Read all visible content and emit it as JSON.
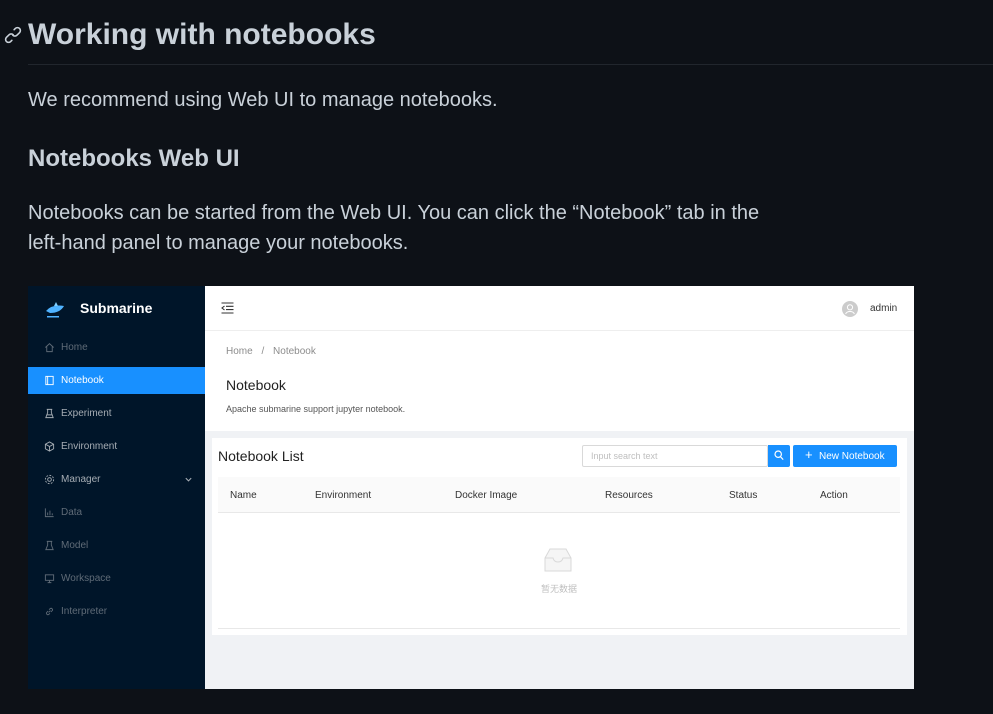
{
  "doc": {
    "heading": "Working with notebooks",
    "intro": "We recommend using Web UI to manage notebooks.",
    "subheading": "Notebooks Web UI",
    "paragraph": "Notebooks can be started from the Web UI. You can click the “Notebook” tab in the left-hand panel to manage your notebooks."
  },
  "app": {
    "brand": "Submarine",
    "menu": [
      {
        "label": "Home",
        "icon": "home-icon"
      },
      {
        "label": "Notebook",
        "icon": "book-icon"
      },
      {
        "label": "Experiment",
        "icon": "flask-icon"
      },
      {
        "label": "Environment",
        "icon": "cube-icon"
      },
      {
        "label": "Manager",
        "icon": "settings-icon"
      },
      {
        "label": "Data",
        "icon": "bar-chart-icon"
      },
      {
        "label": "Model",
        "icon": "experiment-icon"
      },
      {
        "label": "Workspace",
        "icon": "desktop-icon"
      },
      {
        "label": "Interpreter",
        "icon": "link-icon"
      }
    ],
    "user": "admin",
    "breadcrumb": [
      "Home",
      "/",
      "Notebook"
    ],
    "page_title": "Notebook",
    "page_desc": "Apache submarine support jupyter notebook.",
    "list_title": "Notebook List",
    "search_placeholder": "Input search text",
    "new_button": "New Notebook",
    "columns": [
      "Name",
      "Environment",
      "Docker Image",
      "Resources",
      "Status",
      "Action"
    ],
    "empty_text": "暂无数据",
    "colors": {
      "sidebar": "#001529",
      "accent": "#1890ff"
    }
  }
}
